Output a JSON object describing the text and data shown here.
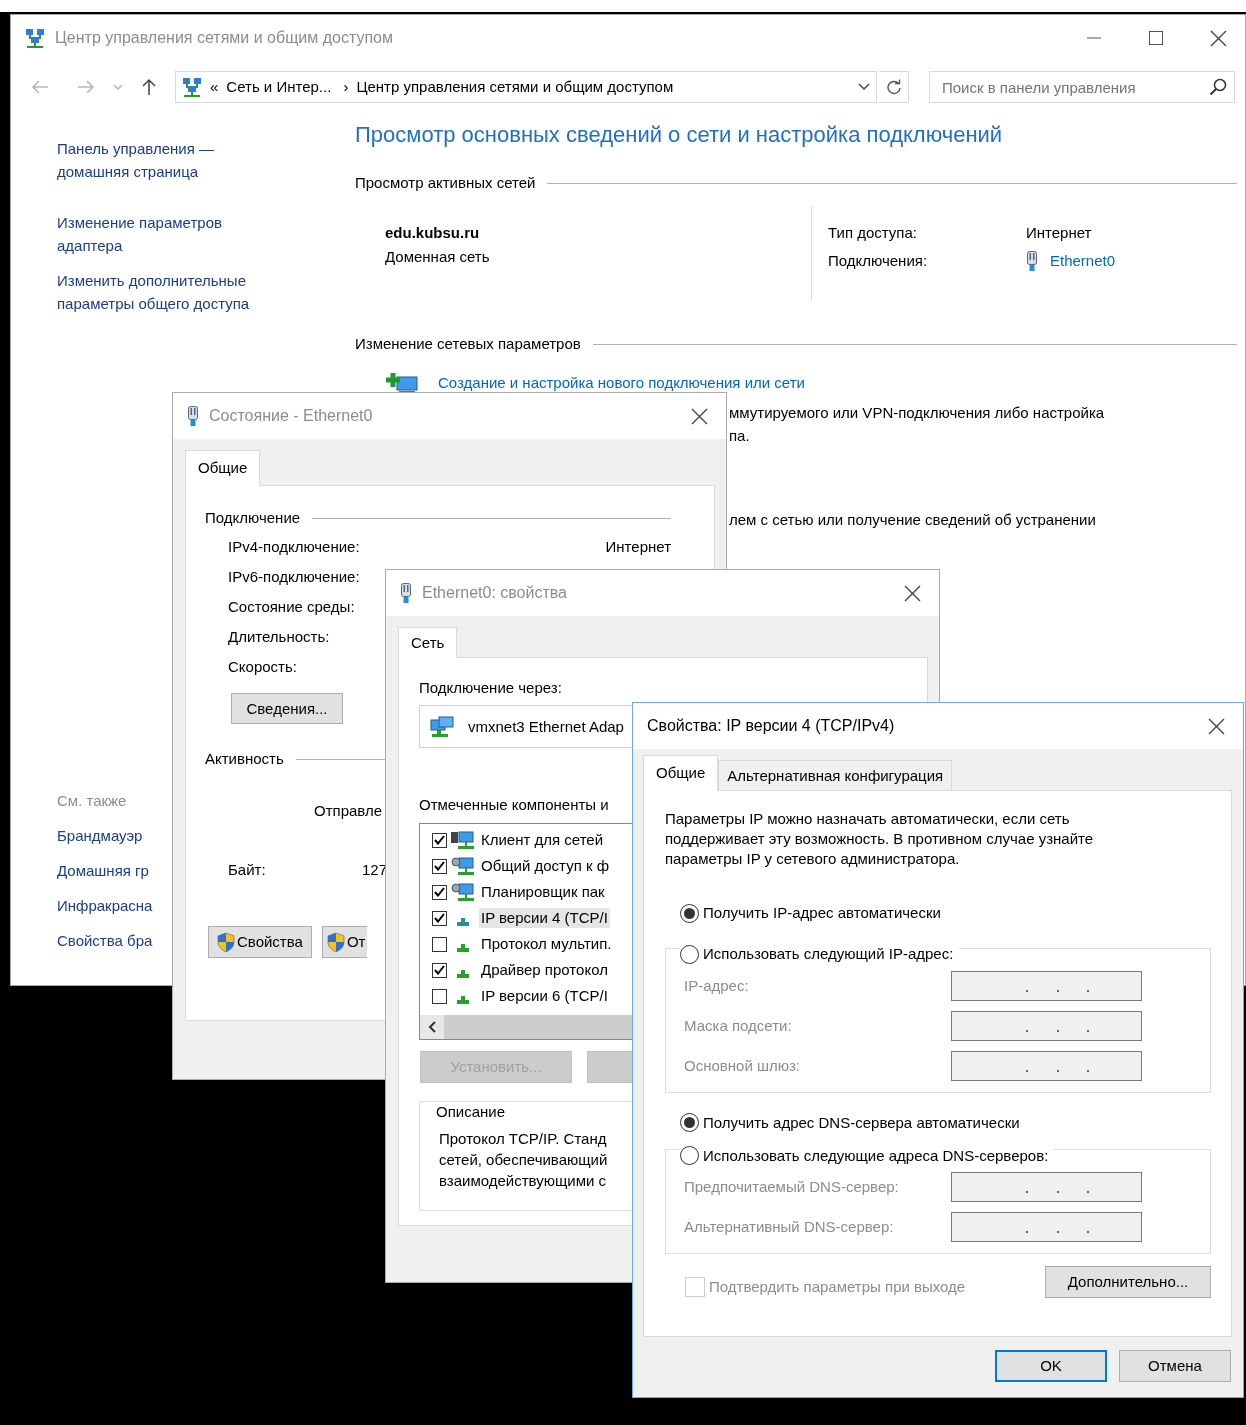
{
  "main_window": {
    "title": "Центр управления сетями и общим доступом",
    "active": false,
    "address_bar": {
      "prefix": "«",
      "crumbs": [
        "Сеть и Интер...",
        "Центр управления сетями и общим доступом"
      ],
      "separator": "›"
    },
    "search": {
      "placeholder": "Поиск в панели управления"
    },
    "sidebar": {
      "links": [
        "Панель управления — домашняя страница",
        "Изменение параметров адаптера",
        "Изменить дополнительные параметры общего доступа"
      ],
      "see_also_title": "См. также",
      "see_also": [
        "Брандмауэр",
        "Домашняя гр",
        "Инфракрасна",
        "Свойства бра"
      ]
    },
    "heading": "Просмотр основных сведений о сети и настройка подключений",
    "active_networks": {
      "title": "Просмотр активных сетей",
      "network_name": "edu.kubsu.ru",
      "network_type": "Доменная сеть",
      "access_label": "Тип доступа:",
      "access_value": "Интернет",
      "connections_label": "Подключения:",
      "connection_link": "Ethernet0"
    },
    "change_settings": {
      "title": "Изменение сетевых параметров",
      "new_connection_link": "Создание и настройка нового подключения или сети",
      "fragments": [
        "ммутируемого или VPN-подключения либо настройка",
        "па.",
        "лем с сетью или получение сведений об устранении"
      ]
    }
  },
  "status_window": {
    "title": "Состояние - Ethernet0",
    "active": false,
    "tabs": [
      {
        "label": "Общие",
        "selected": true
      }
    ],
    "connection_group": "Подключение",
    "rows": [
      {
        "label": "IPv4-подключение:",
        "value": "Интернет"
      },
      {
        "label": "IPv6-подключение:"
      },
      {
        "label": "Состояние среды:"
      },
      {
        "label": "Длительность:"
      },
      {
        "label": "Скорость:"
      }
    ],
    "details_button": "Сведения...",
    "activity_group": "Активность",
    "sent_label": "Отправле",
    "bytes_label": "Байт:",
    "bytes_value": "127",
    "buttons": [
      "Свойства",
      "От"
    ]
  },
  "properties_window": {
    "title": "Ethernet0: свойства",
    "active": false,
    "tabs": [
      {
        "label": "Сеть",
        "selected": true
      }
    ],
    "connect_using_label": "Подключение через:",
    "adapter": "vmxnet3 Ethernet Adap",
    "components_label": "Отмеченные компоненты и",
    "components": [
      {
        "label": "Клиент для сетей",
        "kind": "client",
        "checked": true,
        "selected": false
      },
      {
        "label": "Общий доступ к ф",
        "kind": "service",
        "checked": true,
        "selected": false
      },
      {
        "label": "Планировщик пак",
        "kind": "service",
        "checked": true,
        "selected": false
      },
      {
        "label": "IP версии 4 (TCP/I",
        "kind": "protocol",
        "checked": true,
        "selected": true
      },
      {
        "label": "Протокол мультип.",
        "kind": "protocol",
        "checked": false,
        "selected": false
      },
      {
        "label": "Драйвер протокол",
        "kind": "protocol",
        "checked": true,
        "selected": false
      },
      {
        "label": "IP версии 6 (TCP/I",
        "kind": "protocol",
        "checked": false,
        "selected": false
      }
    ],
    "install_button": {
      "label": "Установить...",
      "disabled": true
    },
    "description_group": "Описание",
    "description": "Протокол TCP/IP. Станд\nсетей, обеспечивающий\nвзаимодействующими с"
  },
  "ipv4_window": {
    "title": "Свойства: IP версии 4 (TCP/IPv4)",
    "active": true,
    "tabs": [
      {
        "label": "Общие",
        "selected": true
      },
      {
        "label": "Альтернативная конфигурация",
        "selected": false
      }
    ],
    "intro": "Параметры IP можно назначать автоматически, если сеть поддерживает эту возможность. В противном случае узнайте параметры IP у сетевого администратора.",
    "ip_mode": [
      {
        "label": "Получить IP-адрес автоматически",
        "selected": true
      },
      {
        "label": "Использовать следующий IP-адрес:",
        "selected": false
      }
    ],
    "ip_fields": [
      {
        "label": "IP-адрес:",
        "disabled": true
      },
      {
        "label": "Маска подсети:",
        "disabled": true
      },
      {
        "label": "Основной шлюз:",
        "disabled": true
      }
    ],
    "dns_mode": [
      {
        "label": "Получить адрес DNS-сервера автоматически",
        "selected": true
      },
      {
        "label": "Использовать следующие адреса DNS-серверов:",
        "selected": false
      }
    ],
    "dns_fields": [
      {
        "label": "Предпочитаемый DNS-сервер:",
        "disabled": true
      },
      {
        "label": "Альтернативный DNS-сервер:",
        "disabled": true
      }
    ],
    "validate": {
      "label": "Подтвердить параметры при выходе",
      "checked": false,
      "disabled": true
    },
    "advanced_button": "Дополнительно...",
    "buttons": [
      {
        "label": "OK",
        "default": true
      },
      {
        "label": "Отмена",
        "default": false
      }
    ]
  }
}
